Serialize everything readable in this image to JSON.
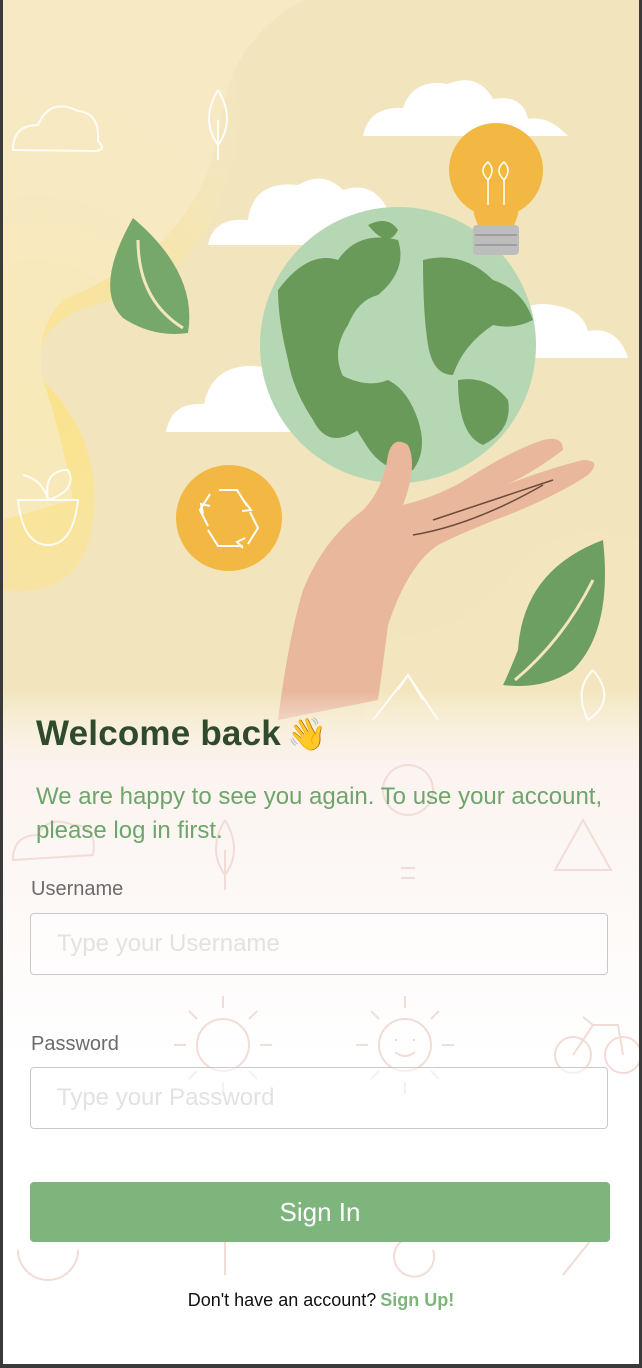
{
  "welcome": {
    "title": "Welcome back",
    "emoji": "👋"
  },
  "subtitle": "We are happy to see you again. To use your account, please log in first.",
  "username": {
    "label": "Username",
    "placeholder": "Type your Username",
    "value": ""
  },
  "password": {
    "label": "Password",
    "placeholder": "Type your Password",
    "value": ""
  },
  "sign_in_button": "Sign In",
  "footer": {
    "prompt": "Don't have an account?",
    "link": "Sign Up!"
  },
  "colors": {
    "accent": "#7db57c",
    "title": "#2f4a2c",
    "subtitle": "#6ea56a",
    "hero_bg": "#f3e6bf"
  },
  "illustration": [
    "globe-illustration",
    "hand-illustration",
    "lightbulb-icon",
    "recycle-icon",
    "leaf-icon",
    "cloud-icon"
  ]
}
